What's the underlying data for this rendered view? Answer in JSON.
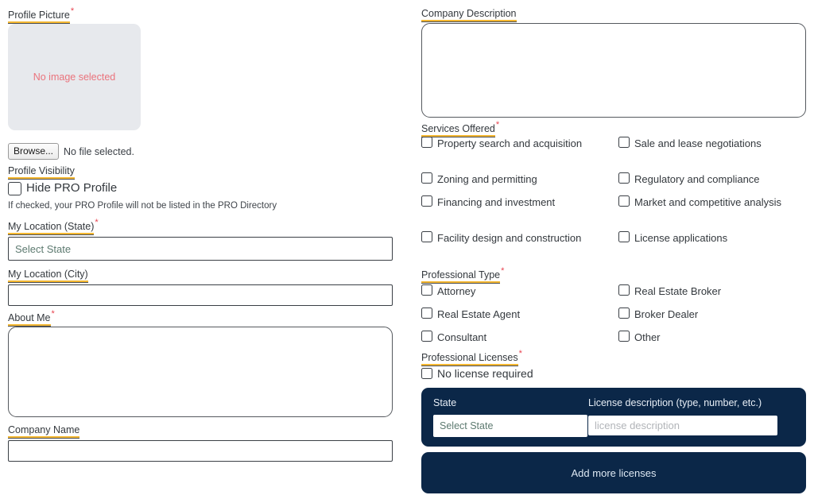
{
  "left": {
    "profile_picture": {
      "label": "Profile Picture",
      "required": "*",
      "empty_text": "No image selected",
      "browse_label": "Browse...",
      "file_status": "No file selected.",
      "placeholder_bg": "#e7e9ed",
      "empty_text_color": "#ea737c"
    },
    "profile_visibility": {
      "label": "Profile Visibility",
      "checkbox_label": "Hide PRO Profile",
      "checked": false,
      "helper": "If checked, your PRO Profile will not be listed in the PRO Directory"
    },
    "location_state": {
      "label": "My Location (State)",
      "required": "*",
      "value": "Select State"
    },
    "location_city": {
      "label": "My Location (City)",
      "required": "",
      "value": "",
      "placeholder": ""
    },
    "about_me": {
      "label": "About Me",
      "required": "*",
      "value": "",
      "placeholder": ""
    },
    "company_name": {
      "label": "Company Name",
      "required": "",
      "value": "",
      "placeholder": ""
    }
  },
  "right": {
    "company_description": {
      "label": "Company Description",
      "required": "",
      "value": "",
      "placeholder": ""
    },
    "services_offered": {
      "label": "Services Offered",
      "required": "*",
      "options": [
        {
          "label": "Property search and acquisition",
          "checked": false
        },
        {
          "label": "Sale and lease negotiations",
          "checked": false
        },
        {
          "label": "Zoning and permitting",
          "checked": false
        },
        {
          "label": "Regulatory and compliance",
          "checked": false
        },
        {
          "label": "Financing and investment",
          "checked": false
        },
        {
          "label": "Market and competitive analysis",
          "checked": false
        },
        {
          "label": "Facility design and construction",
          "checked": false
        },
        {
          "label": "License applications",
          "checked": false
        }
      ]
    },
    "professional_type": {
      "label": "Professional Type",
      "required": "*",
      "options": [
        {
          "label": "Attorney",
          "checked": false
        },
        {
          "label": "Real Estate Broker",
          "checked": false
        },
        {
          "label": "Real Estate Agent",
          "checked": false
        },
        {
          "label": "Broker Dealer",
          "checked": false
        },
        {
          "label": "Consultant",
          "checked": false
        },
        {
          "label": "Other",
          "checked": false
        }
      ]
    },
    "professional_licenses": {
      "label": "Professional Licenses",
      "required": "*",
      "no_license_label": "No license required",
      "no_license_checked": false,
      "panel": {
        "state_label": "State",
        "state_value": "Select State",
        "description_label": "License description (type, number, etc.)",
        "description_value": "",
        "description_placeholder": "license description",
        "bg_color": "#0b2748"
      },
      "add_more_label": "Add more licenses"
    }
  },
  "theme": {
    "label_underline": "#f4b731",
    "required_color": "#e8434f",
    "navy": "#0b2748",
    "select_text": "#5d7a70",
    "text": "#33383d"
  }
}
